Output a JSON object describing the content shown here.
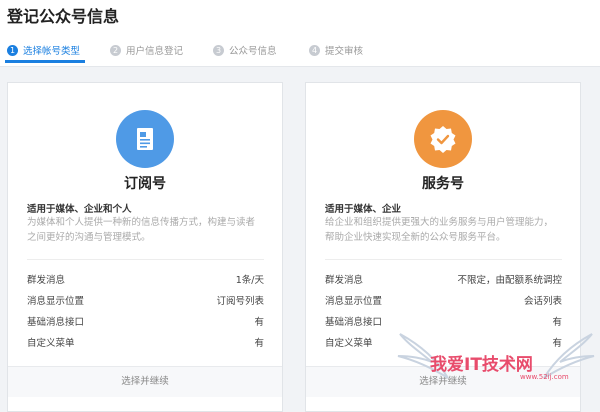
{
  "page": {
    "title": "登记公众号信息"
  },
  "steps": [
    {
      "num": "1",
      "label": "选择帐号类型"
    },
    {
      "num": "2",
      "label": "用户信息登记"
    },
    {
      "num": "3",
      "label": "公众号信息"
    },
    {
      "num": "4",
      "label": "提交审核"
    }
  ],
  "active_step": 1,
  "colors": {
    "accent": "#1a7fe0",
    "subscription_badge": "#4f9ae6",
    "service_badge": "#f0963f",
    "watermark": "#e84c6c"
  },
  "cards": [
    {
      "icon": "document-icon",
      "name": "订阅号",
      "audience": "适用于媒体、企业和个人",
      "description": "为媒体和个人提供一种新的信息传播方式，构建与读者之间更好的沟通与管理模式。",
      "features": [
        {
          "label": "群发消息",
          "value": "1条/天"
        },
        {
          "label": "消息显示位置",
          "value": "订阅号列表"
        },
        {
          "label": "基础消息接口",
          "value": "有"
        },
        {
          "label": "自定义菜单",
          "value": "有"
        }
      ],
      "select_label": "选择并继续"
    },
    {
      "icon": "verified-check-icon",
      "name": "服务号",
      "audience": "适用于媒体、企业",
      "description": "给企业和组织提供更强大的业务服务与用户管理能力，帮助企业快速实现全新的公众号服务平台。",
      "features": [
        {
          "label": "群发消息",
          "value": "不限定，由配额系统调控"
        },
        {
          "label": "消息显示位置",
          "value": "会话列表"
        },
        {
          "label": "基础消息接口",
          "value": "有"
        },
        {
          "label": "自定义菜单",
          "value": "有"
        }
      ],
      "select_label": "选择并继续"
    }
  ],
  "watermark": {
    "text": "我爱IT技术网",
    "url": "www.52ij.com"
  }
}
